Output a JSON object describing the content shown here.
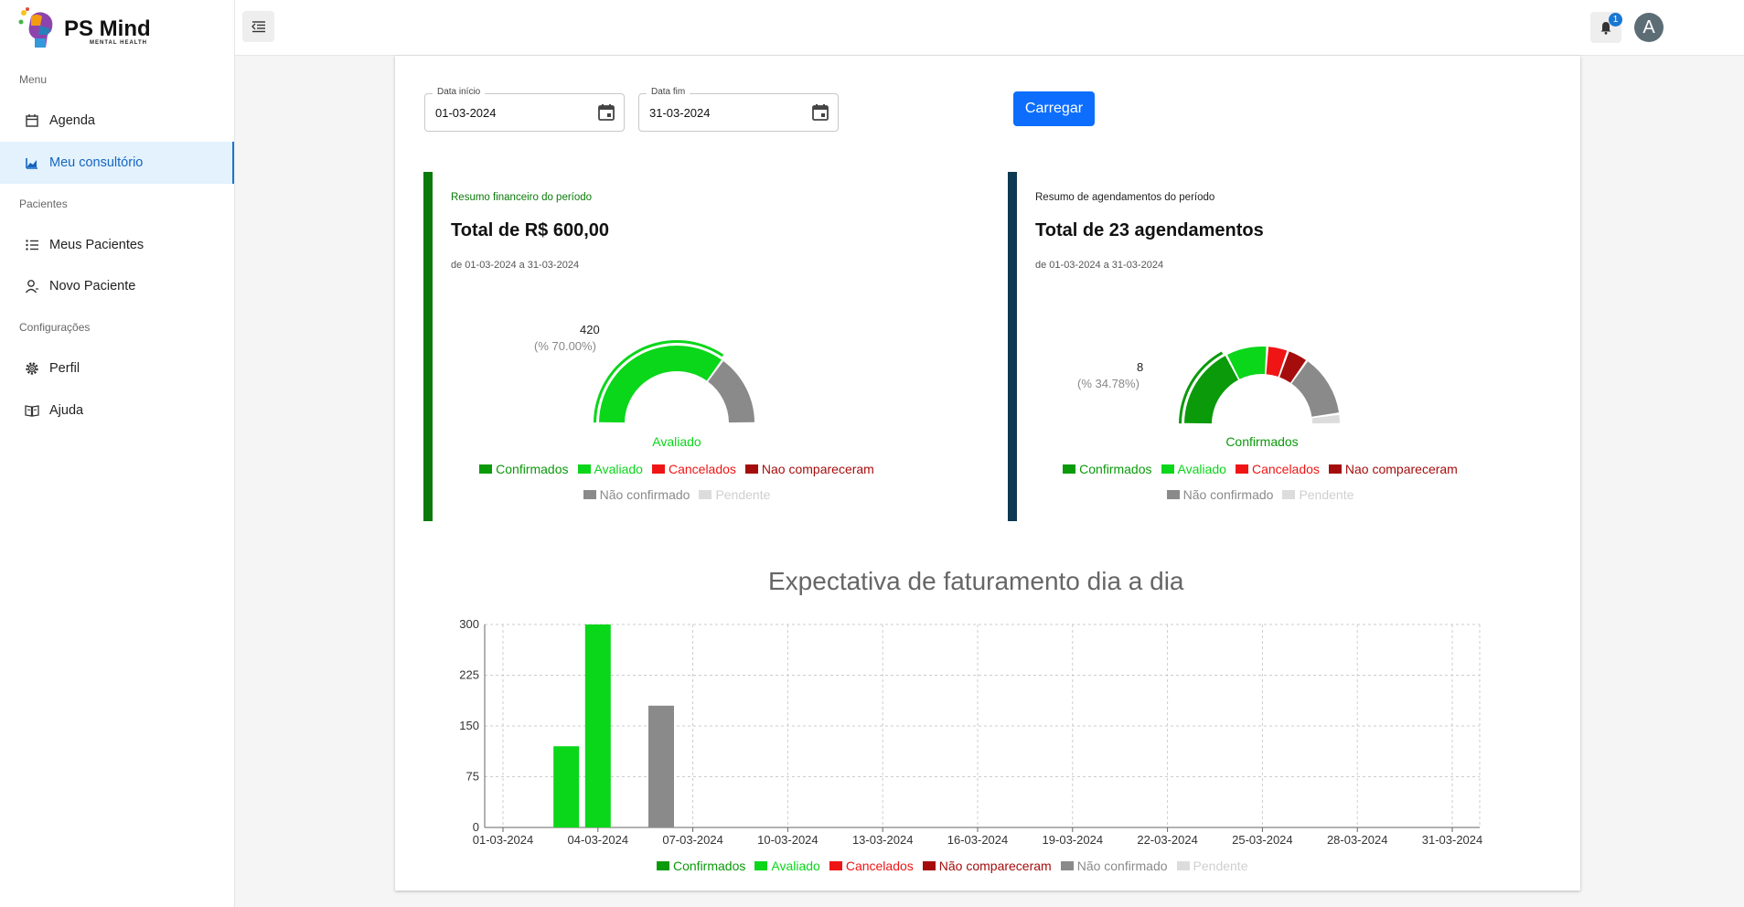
{
  "app": {
    "brand": "PS Mind",
    "brand_sub": "MENTAL HEALTH"
  },
  "sidebar": {
    "sections": [
      {
        "label": "Menu"
      },
      {
        "label": "Pacientes"
      },
      {
        "label": "Configurações"
      }
    ],
    "items": [
      {
        "label": "Agenda",
        "icon": "calendar-icon"
      },
      {
        "label": "Meu consultório",
        "icon": "chart-icon",
        "active": true
      },
      {
        "label": "Meus Pacientes",
        "icon": "list-icon"
      },
      {
        "label": "Novo Paciente",
        "icon": "person-add-icon"
      },
      {
        "label": "Perfil",
        "icon": "gear-icon"
      },
      {
        "label": "Ajuda",
        "icon": "book-icon"
      }
    ]
  },
  "header": {
    "notification_count": "1",
    "avatar_initial": "A"
  },
  "filters": {
    "start_label": "Data início",
    "start_value": "01-03-2024",
    "end_label": "Data fim",
    "end_value": "31-03-2024",
    "load_button": "Carregar"
  },
  "summaries": {
    "financial": {
      "subtitle": "Resumo financeiro do período",
      "title": "Total de R$ 600,00",
      "range": "de 01-03-2024 a 31-03-2024",
      "highlight_value": "420",
      "highlight_pct": "(% 70.00%)",
      "center_label": "Avaliado"
    },
    "appointments": {
      "subtitle": "Resumo de agendamentos do período",
      "title": "Total de 23 agendamentos",
      "range": "de 01-03-2024 a 31-03-2024",
      "highlight_value": "8",
      "highlight_pct": "(% 34.78%)",
      "center_label": "Confirmados"
    }
  },
  "legend": [
    {
      "label": "Confirmados",
      "color": "#0a9a0a"
    },
    {
      "label": "Avaliado",
      "color": "#0ad61a"
    },
    {
      "label": "Cancelados",
      "color": "#f01515"
    },
    {
      "label": "Nao compareceram",
      "color": "#a50d0d"
    },
    {
      "label": "Não confirmado",
      "color": "#8a8a8a"
    },
    {
      "label": "Pendente",
      "color": "#dcdcdc"
    }
  ],
  "bottom_legend": [
    {
      "label": "Confirmados",
      "color": "#0a9a0a"
    },
    {
      "label": "Avaliado",
      "color": "#0ad61a"
    },
    {
      "label": "Cancelados",
      "color": "#f01515"
    },
    {
      "label": "Não compareceram",
      "color": "#a50d0d"
    },
    {
      "label": "Não confirmado",
      "color": "#8a8a8a"
    },
    {
      "label": "Pendente",
      "color": "#dcdcdc"
    }
  ],
  "chart_data": [
    {
      "type": "pie",
      "variant": "half-donut",
      "categories": [
        "Confirmados",
        "Avaliado",
        "Cancelados",
        "Nao compareceram",
        "Não confirmado",
        "Pendente"
      ],
      "values": [
        0,
        420,
        0,
        0,
        180,
        0
      ]
    },
    {
      "type": "pie",
      "variant": "half-donut",
      "categories": [
        "Confirmados",
        "Avaliado",
        "Cancelados",
        "Nao compareceram",
        "Não confirmado",
        "Pendente"
      ],
      "values": [
        8,
        4,
        2,
        2,
        6,
        1
      ]
    },
    {
      "type": "bar",
      "title": "Expectativa de faturamento dia a dia",
      "ylim": [
        0,
        300
      ],
      "yticks": [
        0,
        75,
        150,
        225,
        300
      ],
      "xticks": [
        "01-03-2024",
        "04-03-2024",
        "07-03-2024",
        "10-03-2024",
        "13-03-2024",
        "16-03-2024",
        "19-03-2024",
        "22-03-2024",
        "25-03-2024",
        "28-03-2024",
        "31-03-2024"
      ],
      "bars": [
        {
          "date": "03-03-2024",
          "series": "Avaliado",
          "value": 120
        },
        {
          "date": "04-03-2024",
          "series": "Avaliado",
          "value": 300
        },
        {
          "date": "06-03-2024",
          "series": "Não confirmado",
          "value": 180
        }
      ]
    }
  ]
}
